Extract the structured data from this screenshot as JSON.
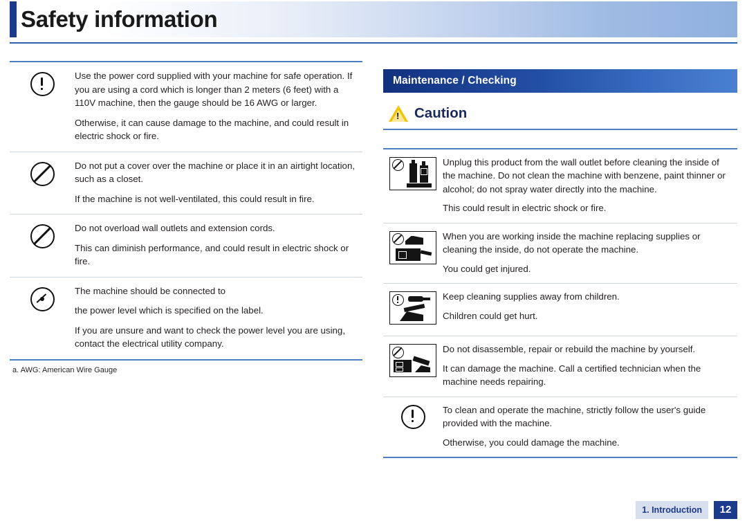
{
  "header": {
    "title": "Safety information"
  },
  "left": {
    "rows": [
      {
        "icon": "exclamation-circle-icon",
        "paragraphs": [
          "Use the power cord supplied with your machine for safe operation. If you are using a cord which is longer than 2 meters (6 feet) with a 110V machine, then the gauge should be 16 AWG or larger.",
          "Otherwise, it can cause damage to the machine, and could result in electric shock or fire."
        ]
      },
      {
        "icon": "prohibition-icon",
        "paragraphs": [
          "Do not put a cover over the machine or place it in an airtight location, such as a closet.",
          "If the machine is not well-ventilated, this could result in fire."
        ]
      },
      {
        "icon": "prohibition-icon",
        "paragraphs": [
          "Do not overload wall outlets and extension cords.",
          "This can diminish performance, and could result in electric shock or fire."
        ]
      },
      {
        "icon": "unplug-icon",
        "paragraphs": [
          "The machine should be connected to",
          "the power level which is specified on the label.",
          "If you are unsure and want to check the power level you are using, contact the electrical utility company."
        ]
      }
    ],
    "footnote": "a.  AWG: American Wire Gauge"
  },
  "right": {
    "section_title": "Maintenance / Checking",
    "caution_label": "Caution",
    "rows": [
      {
        "icon": "no-cleaning-solvent-icon",
        "paragraphs": [
          "Unplug this product from the wall outlet before cleaning the inside of the machine. Do not clean the machine with benzene, paint thinner or alcohol; do not spray water directly into the machine.",
          "This could result in electric shock or fire."
        ]
      },
      {
        "icon": "no-operate-while-servicing-icon",
        "paragraphs": [
          "When you are working inside the machine replacing supplies or cleaning the inside, do not operate the machine.",
          "You could get injured."
        ]
      },
      {
        "icon": "keep-away-from-children-icon",
        "paragraphs": [
          "Keep cleaning supplies away from children.",
          "Children could get hurt."
        ]
      },
      {
        "icon": "no-disassemble-icon",
        "paragraphs": [
          "Do not disassemble, repair or rebuild the machine by yourself.",
          "It can damage the machine. Call a certified technician when the machine needs repairing."
        ]
      },
      {
        "icon": "exclamation-circle-icon",
        "paragraphs": [
          "To clean and operate the machine, strictly follow the user's guide provided with the machine.",
          "Otherwise, you could damage the machine."
        ]
      }
    ]
  },
  "footer": {
    "chapter": "1. Introduction",
    "page": "12"
  },
  "colors": {
    "accent_blue": "#1b3a8c",
    "rule_blue": "#4a7fc1",
    "caution_yellow": "#f5c400",
    "footer_chip": "#d7dfef"
  }
}
